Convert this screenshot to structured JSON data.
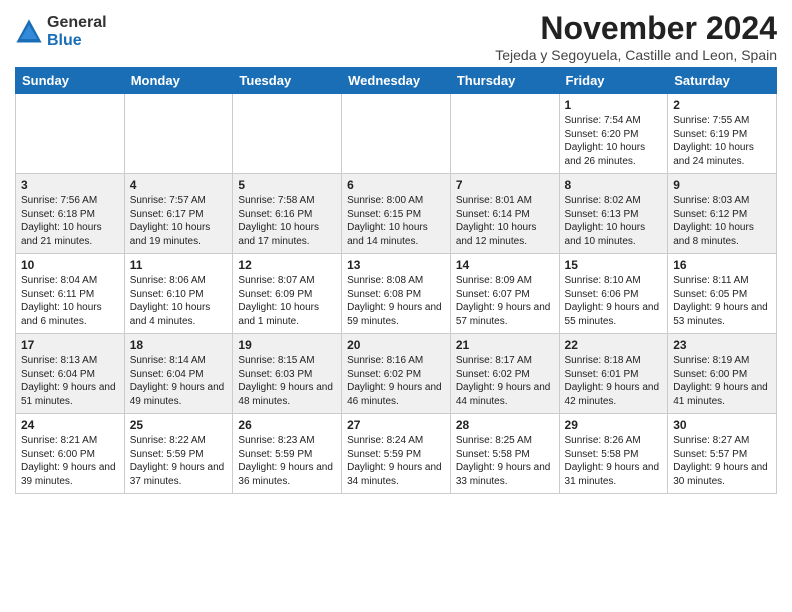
{
  "logo": {
    "general": "General",
    "blue": "Blue"
  },
  "title": "November 2024",
  "location": "Tejeda y Segoyuela, Castille and Leon, Spain",
  "days_of_week": [
    "Sunday",
    "Monday",
    "Tuesday",
    "Wednesday",
    "Thursday",
    "Friday",
    "Saturday"
  ],
  "weeks": [
    [
      {
        "day": "",
        "info": ""
      },
      {
        "day": "",
        "info": ""
      },
      {
        "day": "",
        "info": ""
      },
      {
        "day": "",
        "info": ""
      },
      {
        "day": "",
        "info": ""
      },
      {
        "day": "1",
        "info": "Sunrise: 7:54 AM\nSunset: 6:20 PM\nDaylight: 10 hours and 26 minutes."
      },
      {
        "day": "2",
        "info": "Sunrise: 7:55 AM\nSunset: 6:19 PM\nDaylight: 10 hours and 24 minutes."
      }
    ],
    [
      {
        "day": "3",
        "info": "Sunrise: 7:56 AM\nSunset: 6:18 PM\nDaylight: 10 hours and 21 minutes."
      },
      {
        "day": "4",
        "info": "Sunrise: 7:57 AM\nSunset: 6:17 PM\nDaylight: 10 hours and 19 minutes."
      },
      {
        "day": "5",
        "info": "Sunrise: 7:58 AM\nSunset: 6:16 PM\nDaylight: 10 hours and 17 minutes."
      },
      {
        "day": "6",
        "info": "Sunrise: 8:00 AM\nSunset: 6:15 PM\nDaylight: 10 hours and 14 minutes."
      },
      {
        "day": "7",
        "info": "Sunrise: 8:01 AM\nSunset: 6:14 PM\nDaylight: 10 hours and 12 minutes."
      },
      {
        "day": "8",
        "info": "Sunrise: 8:02 AM\nSunset: 6:13 PM\nDaylight: 10 hours and 10 minutes."
      },
      {
        "day": "9",
        "info": "Sunrise: 8:03 AM\nSunset: 6:12 PM\nDaylight: 10 hours and 8 minutes."
      }
    ],
    [
      {
        "day": "10",
        "info": "Sunrise: 8:04 AM\nSunset: 6:11 PM\nDaylight: 10 hours and 6 minutes."
      },
      {
        "day": "11",
        "info": "Sunrise: 8:06 AM\nSunset: 6:10 PM\nDaylight: 10 hours and 4 minutes."
      },
      {
        "day": "12",
        "info": "Sunrise: 8:07 AM\nSunset: 6:09 PM\nDaylight: 10 hours and 1 minute."
      },
      {
        "day": "13",
        "info": "Sunrise: 8:08 AM\nSunset: 6:08 PM\nDaylight: 9 hours and 59 minutes."
      },
      {
        "day": "14",
        "info": "Sunrise: 8:09 AM\nSunset: 6:07 PM\nDaylight: 9 hours and 57 minutes."
      },
      {
        "day": "15",
        "info": "Sunrise: 8:10 AM\nSunset: 6:06 PM\nDaylight: 9 hours and 55 minutes."
      },
      {
        "day": "16",
        "info": "Sunrise: 8:11 AM\nSunset: 6:05 PM\nDaylight: 9 hours and 53 minutes."
      }
    ],
    [
      {
        "day": "17",
        "info": "Sunrise: 8:13 AM\nSunset: 6:04 PM\nDaylight: 9 hours and 51 minutes."
      },
      {
        "day": "18",
        "info": "Sunrise: 8:14 AM\nSunset: 6:04 PM\nDaylight: 9 hours and 49 minutes."
      },
      {
        "day": "19",
        "info": "Sunrise: 8:15 AM\nSunset: 6:03 PM\nDaylight: 9 hours and 48 minutes."
      },
      {
        "day": "20",
        "info": "Sunrise: 8:16 AM\nSunset: 6:02 PM\nDaylight: 9 hours and 46 minutes."
      },
      {
        "day": "21",
        "info": "Sunrise: 8:17 AM\nSunset: 6:02 PM\nDaylight: 9 hours and 44 minutes."
      },
      {
        "day": "22",
        "info": "Sunrise: 8:18 AM\nSunset: 6:01 PM\nDaylight: 9 hours and 42 minutes."
      },
      {
        "day": "23",
        "info": "Sunrise: 8:19 AM\nSunset: 6:00 PM\nDaylight: 9 hours and 41 minutes."
      }
    ],
    [
      {
        "day": "24",
        "info": "Sunrise: 8:21 AM\nSunset: 6:00 PM\nDaylight: 9 hours and 39 minutes."
      },
      {
        "day": "25",
        "info": "Sunrise: 8:22 AM\nSunset: 5:59 PM\nDaylight: 9 hours and 37 minutes."
      },
      {
        "day": "26",
        "info": "Sunrise: 8:23 AM\nSunset: 5:59 PM\nDaylight: 9 hours and 36 minutes."
      },
      {
        "day": "27",
        "info": "Sunrise: 8:24 AM\nSunset: 5:59 PM\nDaylight: 9 hours and 34 minutes."
      },
      {
        "day": "28",
        "info": "Sunrise: 8:25 AM\nSunset: 5:58 PM\nDaylight: 9 hours and 33 minutes."
      },
      {
        "day": "29",
        "info": "Sunrise: 8:26 AM\nSunset: 5:58 PM\nDaylight: 9 hours and 31 minutes."
      },
      {
        "day": "30",
        "info": "Sunrise: 8:27 AM\nSunset: 5:57 PM\nDaylight: 9 hours and 30 minutes."
      }
    ]
  ]
}
